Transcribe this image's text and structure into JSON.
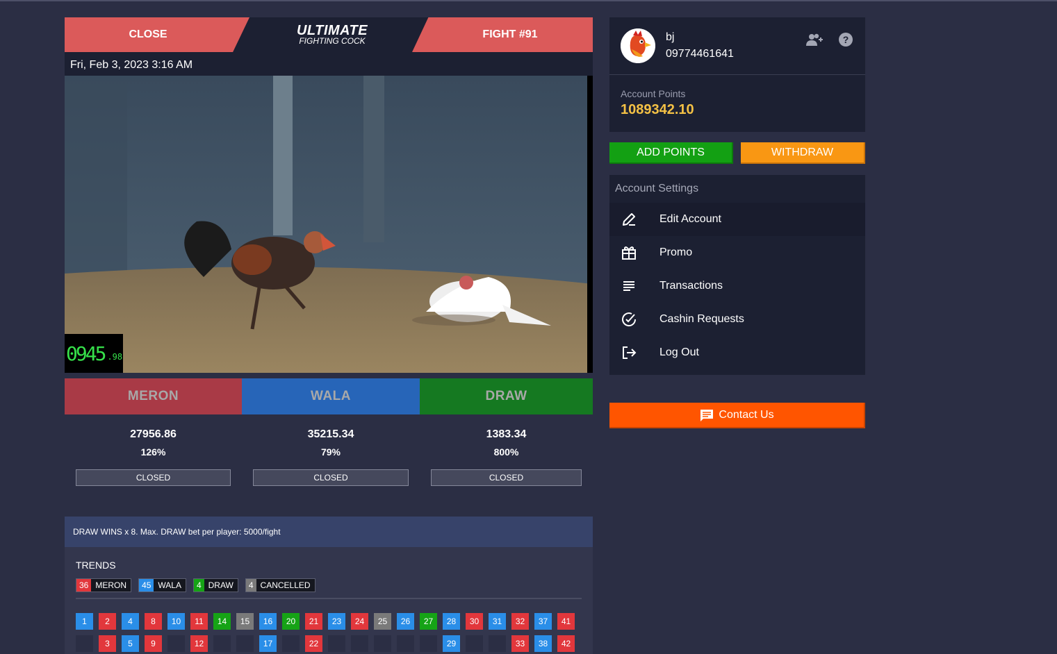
{
  "header": {
    "close_label": "CLOSE",
    "logo_main": "ULTIMATE",
    "logo_sub": "FIGHTING COCK",
    "fight_label": "FIGHT #91"
  },
  "datetime": "Fri, Feb 3, 2023 3:16 AM",
  "video": {
    "timer_main": "0945",
    "timer_small": ".98"
  },
  "bets": [
    {
      "label": "MERON",
      "amount": "27956.86",
      "payout": "126%",
      "status": "CLOSED"
    },
    {
      "label": "WALA",
      "amount": "35215.34",
      "payout": "79%",
      "status": "CLOSED"
    },
    {
      "label": "DRAW",
      "amount": "1383.34",
      "payout": "800%",
      "status": "CLOSED"
    }
  ],
  "notice": "DRAW WINS x 8. Max. DRAW bet per player: 5000/fight",
  "trends": {
    "title": "TRENDS",
    "legend": [
      {
        "count": "36",
        "label": "MERON",
        "color": "#e2373c"
      },
      {
        "count": "45",
        "label": "WALA",
        "color": "#2a8ee8"
      },
      {
        "count": "4",
        "label": "DRAW",
        "color": "#16a316"
      },
      {
        "count": "4",
        "label": "CANCELLED",
        "color": "#7a7a7a"
      }
    ],
    "row1": [
      {
        "n": "1",
        "t": "wala"
      },
      {
        "n": "2",
        "t": "meron"
      },
      {
        "n": "4",
        "t": "wala"
      },
      {
        "n": "8",
        "t": "meron"
      },
      {
        "n": "10",
        "t": "wala"
      },
      {
        "n": "11",
        "t": "meron"
      },
      {
        "n": "14",
        "t": "draw"
      },
      {
        "n": "15",
        "t": "cancel"
      },
      {
        "n": "16",
        "t": "wala"
      },
      {
        "n": "20",
        "t": "draw"
      },
      {
        "n": "21",
        "t": "meron"
      },
      {
        "n": "23",
        "t": "wala"
      },
      {
        "n": "24",
        "t": "meron"
      },
      {
        "n": "25",
        "t": "cancel"
      },
      {
        "n": "26",
        "t": "wala"
      },
      {
        "n": "27",
        "t": "draw"
      },
      {
        "n": "28",
        "t": "wala"
      },
      {
        "n": "30",
        "t": "meron"
      },
      {
        "n": "31",
        "t": "wala"
      },
      {
        "n": "32",
        "t": "meron"
      },
      {
        "n": "37",
        "t": "wala"
      },
      {
        "n": "41",
        "t": "meron"
      }
    ],
    "row2": [
      {
        "n": "",
        "t": "empty"
      },
      {
        "n": "3",
        "t": "meron"
      },
      {
        "n": "5",
        "t": "wala"
      },
      {
        "n": "9",
        "t": "meron"
      },
      {
        "n": "",
        "t": "empty"
      },
      {
        "n": "12",
        "t": "meron"
      },
      {
        "n": "",
        "t": "empty"
      },
      {
        "n": "",
        "t": "empty"
      },
      {
        "n": "17",
        "t": "wala"
      },
      {
        "n": "",
        "t": "empty"
      },
      {
        "n": "22",
        "t": "meron"
      },
      {
        "n": "",
        "t": "empty"
      },
      {
        "n": "",
        "t": "empty"
      },
      {
        "n": "",
        "t": "empty"
      },
      {
        "n": "",
        "t": "empty"
      },
      {
        "n": "",
        "t": "empty"
      },
      {
        "n": "29",
        "t": "wala"
      },
      {
        "n": "",
        "t": "empty"
      },
      {
        "n": "",
        "t": "empty"
      },
      {
        "n": "33",
        "t": "meron"
      },
      {
        "n": "38",
        "t": "wala"
      },
      {
        "n": "42",
        "t": "meron"
      }
    ]
  },
  "profile": {
    "username": "bj",
    "phone": "09774461641",
    "points_label": "Account Points",
    "points_value": "1089342.10"
  },
  "actions": {
    "add_points": "ADD POINTS",
    "withdraw": "WITHDRAW"
  },
  "settings": {
    "title": "Account Settings",
    "items": [
      {
        "label": "Edit Account",
        "icon": "pencil-icon"
      },
      {
        "label": "Promo",
        "icon": "gift-icon"
      },
      {
        "label": "Transactions",
        "icon": "list-icon"
      },
      {
        "label": "Cashin Requests",
        "icon": "check-circle-icon"
      },
      {
        "label": "Log Out",
        "icon": "logout-icon"
      }
    ]
  },
  "contact_label": "Contact Us",
  "colors": {
    "meron": "#e2373c",
    "wala": "#2a8ee8",
    "draw": "#16a316",
    "cancel": "#7a7a7a",
    "empty": "#2b2e44",
    "points": "#f4c145",
    "contact": "#ff5500"
  }
}
